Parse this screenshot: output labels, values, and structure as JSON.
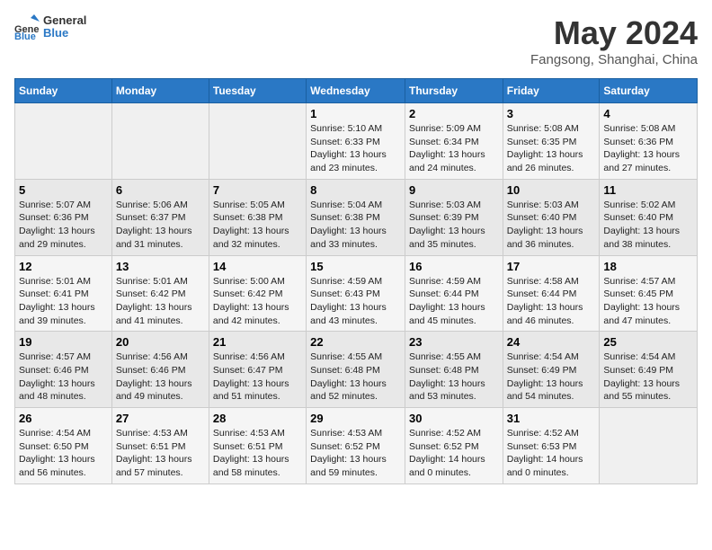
{
  "logo": {
    "line1": "General",
    "line2": "Blue"
  },
  "title": "May 2024",
  "location": "Fangsong, Shanghai, China",
  "days_of_week": [
    "Sunday",
    "Monday",
    "Tuesday",
    "Wednesday",
    "Thursday",
    "Friday",
    "Saturday"
  ],
  "weeks": [
    [
      {
        "day": "",
        "info": ""
      },
      {
        "day": "",
        "info": ""
      },
      {
        "day": "",
        "info": ""
      },
      {
        "day": "1",
        "info": "Sunrise: 5:10 AM\nSunset: 6:33 PM\nDaylight: 13 hours\nand 23 minutes."
      },
      {
        "day": "2",
        "info": "Sunrise: 5:09 AM\nSunset: 6:34 PM\nDaylight: 13 hours\nand 24 minutes."
      },
      {
        "day": "3",
        "info": "Sunrise: 5:08 AM\nSunset: 6:35 PM\nDaylight: 13 hours\nand 26 minutes."
      },
      {
        "day": "4",
        "info": "Sunrise: 5:08 AM\nSunset: 6:36 PM\nDaylight: 13 hours\nand 27 minutes."
      }
    ],
    [
      {
        "day": "5",
        "info": "Sunrise: 5:07 AM\nSunset: 6:36 PM\nDaylight: 13 hours\nand 29 minutes."
      },
      {
        "day": "6",
        "info": "Sunrise: 5:06 AM\nSunset: 6:37 PM\nDaylight: 13 hours\nand 31 minutes."
      },
      {
        "day": "7",
        "info": "Sunrise: 5:05 AM\nSunset: 6:38 PM\nDaylight: 13 hours\nand 32 minutes."
      },
      {
        "day": "8",
        "info": "Sunrise: 5:04 AM\nSunset: 6:38 PM\nDaylight: 13 hours\nand 33 minutes."
      },
      {
        "day": "9",
        "info": "Sunrise: 5:03 AM\nSunset: 6:39 PM\nDaylight: 13 hours\nand 35 minutes."
      },
      {
        "day": "10",
        "info": "Sunrise: 5:03 AM\nSunset: 6:40 PM\nDaylight: 13 hours\nand 36 minutes."
      },
      {
        "day": "11",
        "info": "Sunrise: 5:02 AM\nSunset: 6:40 PM\nDaylight: 13 hours\nand 38 minutes."
      }
    ],
    [
      {
        "day": "12",
        "info": "Sunrise: 5:01 AM\nSunset: 6:41 PM\nDaylight: 13 hours\nand 39 minutes."
      },
      {
        "day": "13",
        "info": "Sunrise: 5:01 AM\nSunset: 6:42 PM\nDaylight: 13 hours\nand 41 minutes."
      },
      {
        "day": "14",
        "info": "Sunrise: 5:00 AM\nSunset: 6:42 PM\nDaylight: 13 hours\nand 42 minutes."
      },
      {
        "day": "15",
        "info": "Sunrise: 4:59 AM\nSunset: 6:43 PM\nDaylight: 13 hours\nand 43 minutes."
      },
      {
        "day": "16",
        "info": "Sunrise: 4:59 AM\nSunset: 6:44 PM\nDaylight: 13 hours\nand 45 minutes."
      },
      {
        "day": "17",
        "info": "Sunrise: 4:58 AM\nSunset: 6:44 PM\nDaylight: 13 hours\nand 46 minutes."
      },
      {
        "day": "18",
        "info": "Sunrise: 4:57 AM\nSunset: 6:45 PM\nDaylight: 13 hours\nand 47 minutes."
      }
    ],
    [
      {
        "day": "19",
        "info": "Sunrise: 4:57 AM\nSunset: 6:46 PM\nDaylight: 13 hours\nand 48 minutes."
      },
      {
        "day": "20",
        "info": "Sunrise: 4:56 AM\nSunset: 6:46 PM\nDaylight: 13 hours\nand 49 minutes."
      },
      {
        "day": "21",
        "info": "Sunrise: 4:56 AM\nSunset: 6:47 PM\nDaylight: 13 hours\nand 51 minutes."
      },
      {
        "day": "22",
        "info": "Sunrise: 4:55 AM\nSunset: 6:48 PM\nDaylight: 13 hours\nand 52 minutes."
      },
      {
        "day": "23",
        "info": "Sunrise: 4:55 AM\nSunset: 6:48 PM\nDaylight: 13 hours\nand 53 minutes."
      },
      {
        "day": "24",
        "info": "Sunrise: 4:54 AM\nSunset: 6:49 PM\nDaylight: 13 hours\nand 54 minutes."
      },
      {
        "day": "25",
        "info": "Sunrise: 4:54 AM\nSunset: 6:49 PM\nDaylight: 13 hours\nand 55 minutes."
      }
    ],
    [
      {
        "day": "26",
        "info": "Sunrise: 4:54 AM\nSunset: 6:50 PM\nDaylight: 13 hours\nand 56 minutes."
      },
      {
        "day": "27",
        "info": "Sunrise: 4:53 AM\nSunset: 6:51 PM\nDaylight: 13 hours\nand 57 minutes."
      },
      {
        "day": "28",
        "info": "Sunrise: 4:53 AM\nSunset: 6:51 PM\nDaylight: 13 hours\nand 58 minutes."
      },
      {
        "day": "29",
        "info": "Sunrise: 4:53 AM\nSunset: 6:52 PM\nDaylight: 13 hours\nand 59 minutes."
      },
      {
        "day": "30",
        "info": "Sunrise: 4:52 AM\nSunset: 6:52 PM\nDaylight: 14 hours\nand 0 minutes."
      },
      {
        "day": "31",
        "info": "Sunrise: 4:52 AM\nSunset: 6:53 PM\nDaylight: 14 hours\nand 0 minutes."
      },
      {
        "day": "",
        "info": ""
      }
    ]
  ]
}
